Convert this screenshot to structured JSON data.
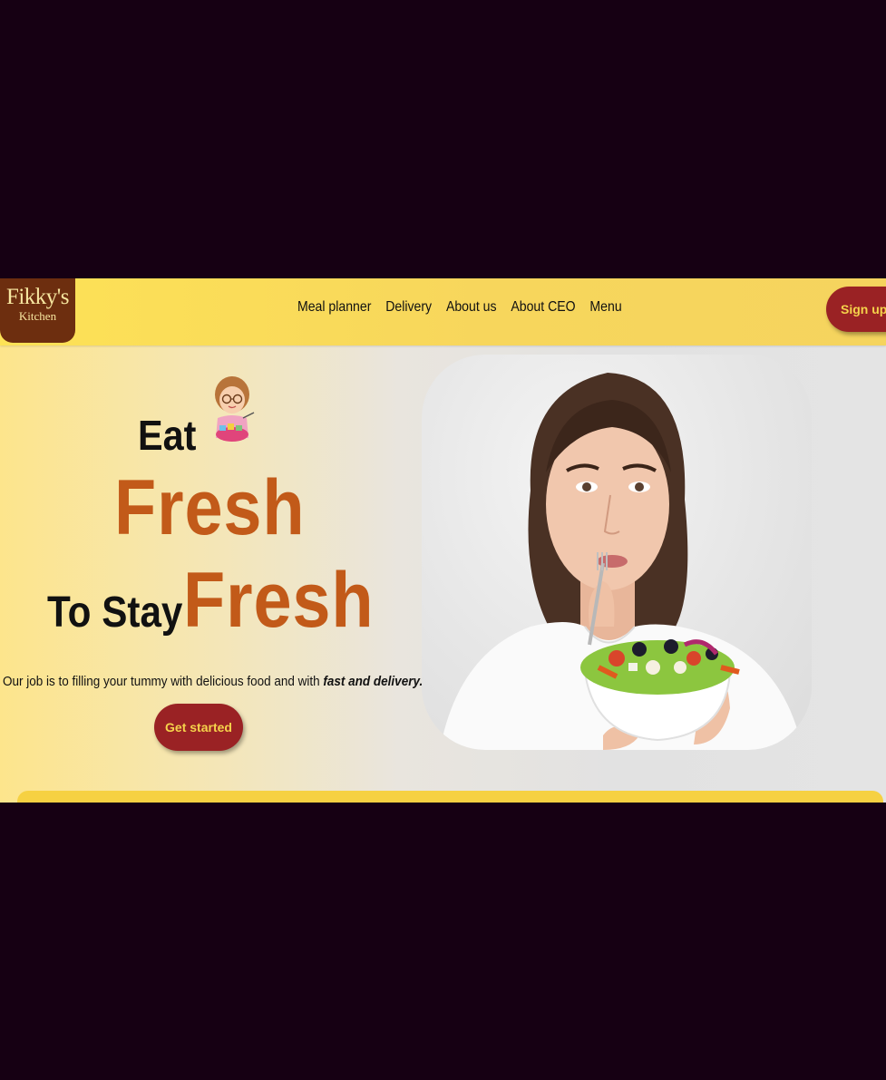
{
  "logo": {
    "line1": "Fikky's",
    "line2": "Kitchen"
  },
  "nav": {
    "items": [
      "Meal planner",
      "Delivery",
      "About us",
      "About CEO",
      "Menu"
    ],
    "signup_label": "Sign up"
  },
  "hero": {
    "eat": "Eat",
    "fresh_1": "Fresh",
    "to_stay": "To Stay",
    "fresh_2": "Fresh",
    "tagline_plain": "Our job is to filling your tummy with delicious food and with ",
    "tagline_emphasis": "fast and delivery.",
    "cta_label": "Get started"
  },
  "colors": {
    "page_bg": "#160013",
    "navbar": "#fde256",
    "accent_red": "#9a2224",
    "button_text": "#f5d34b",
    "fresh_orange": "#c25a19",
    "logo_brown": "#6d2e0f"
  },
  "icons": [
    "chef-lady-illustration",
    "woman-eating-salad-photo"
  ]
}
